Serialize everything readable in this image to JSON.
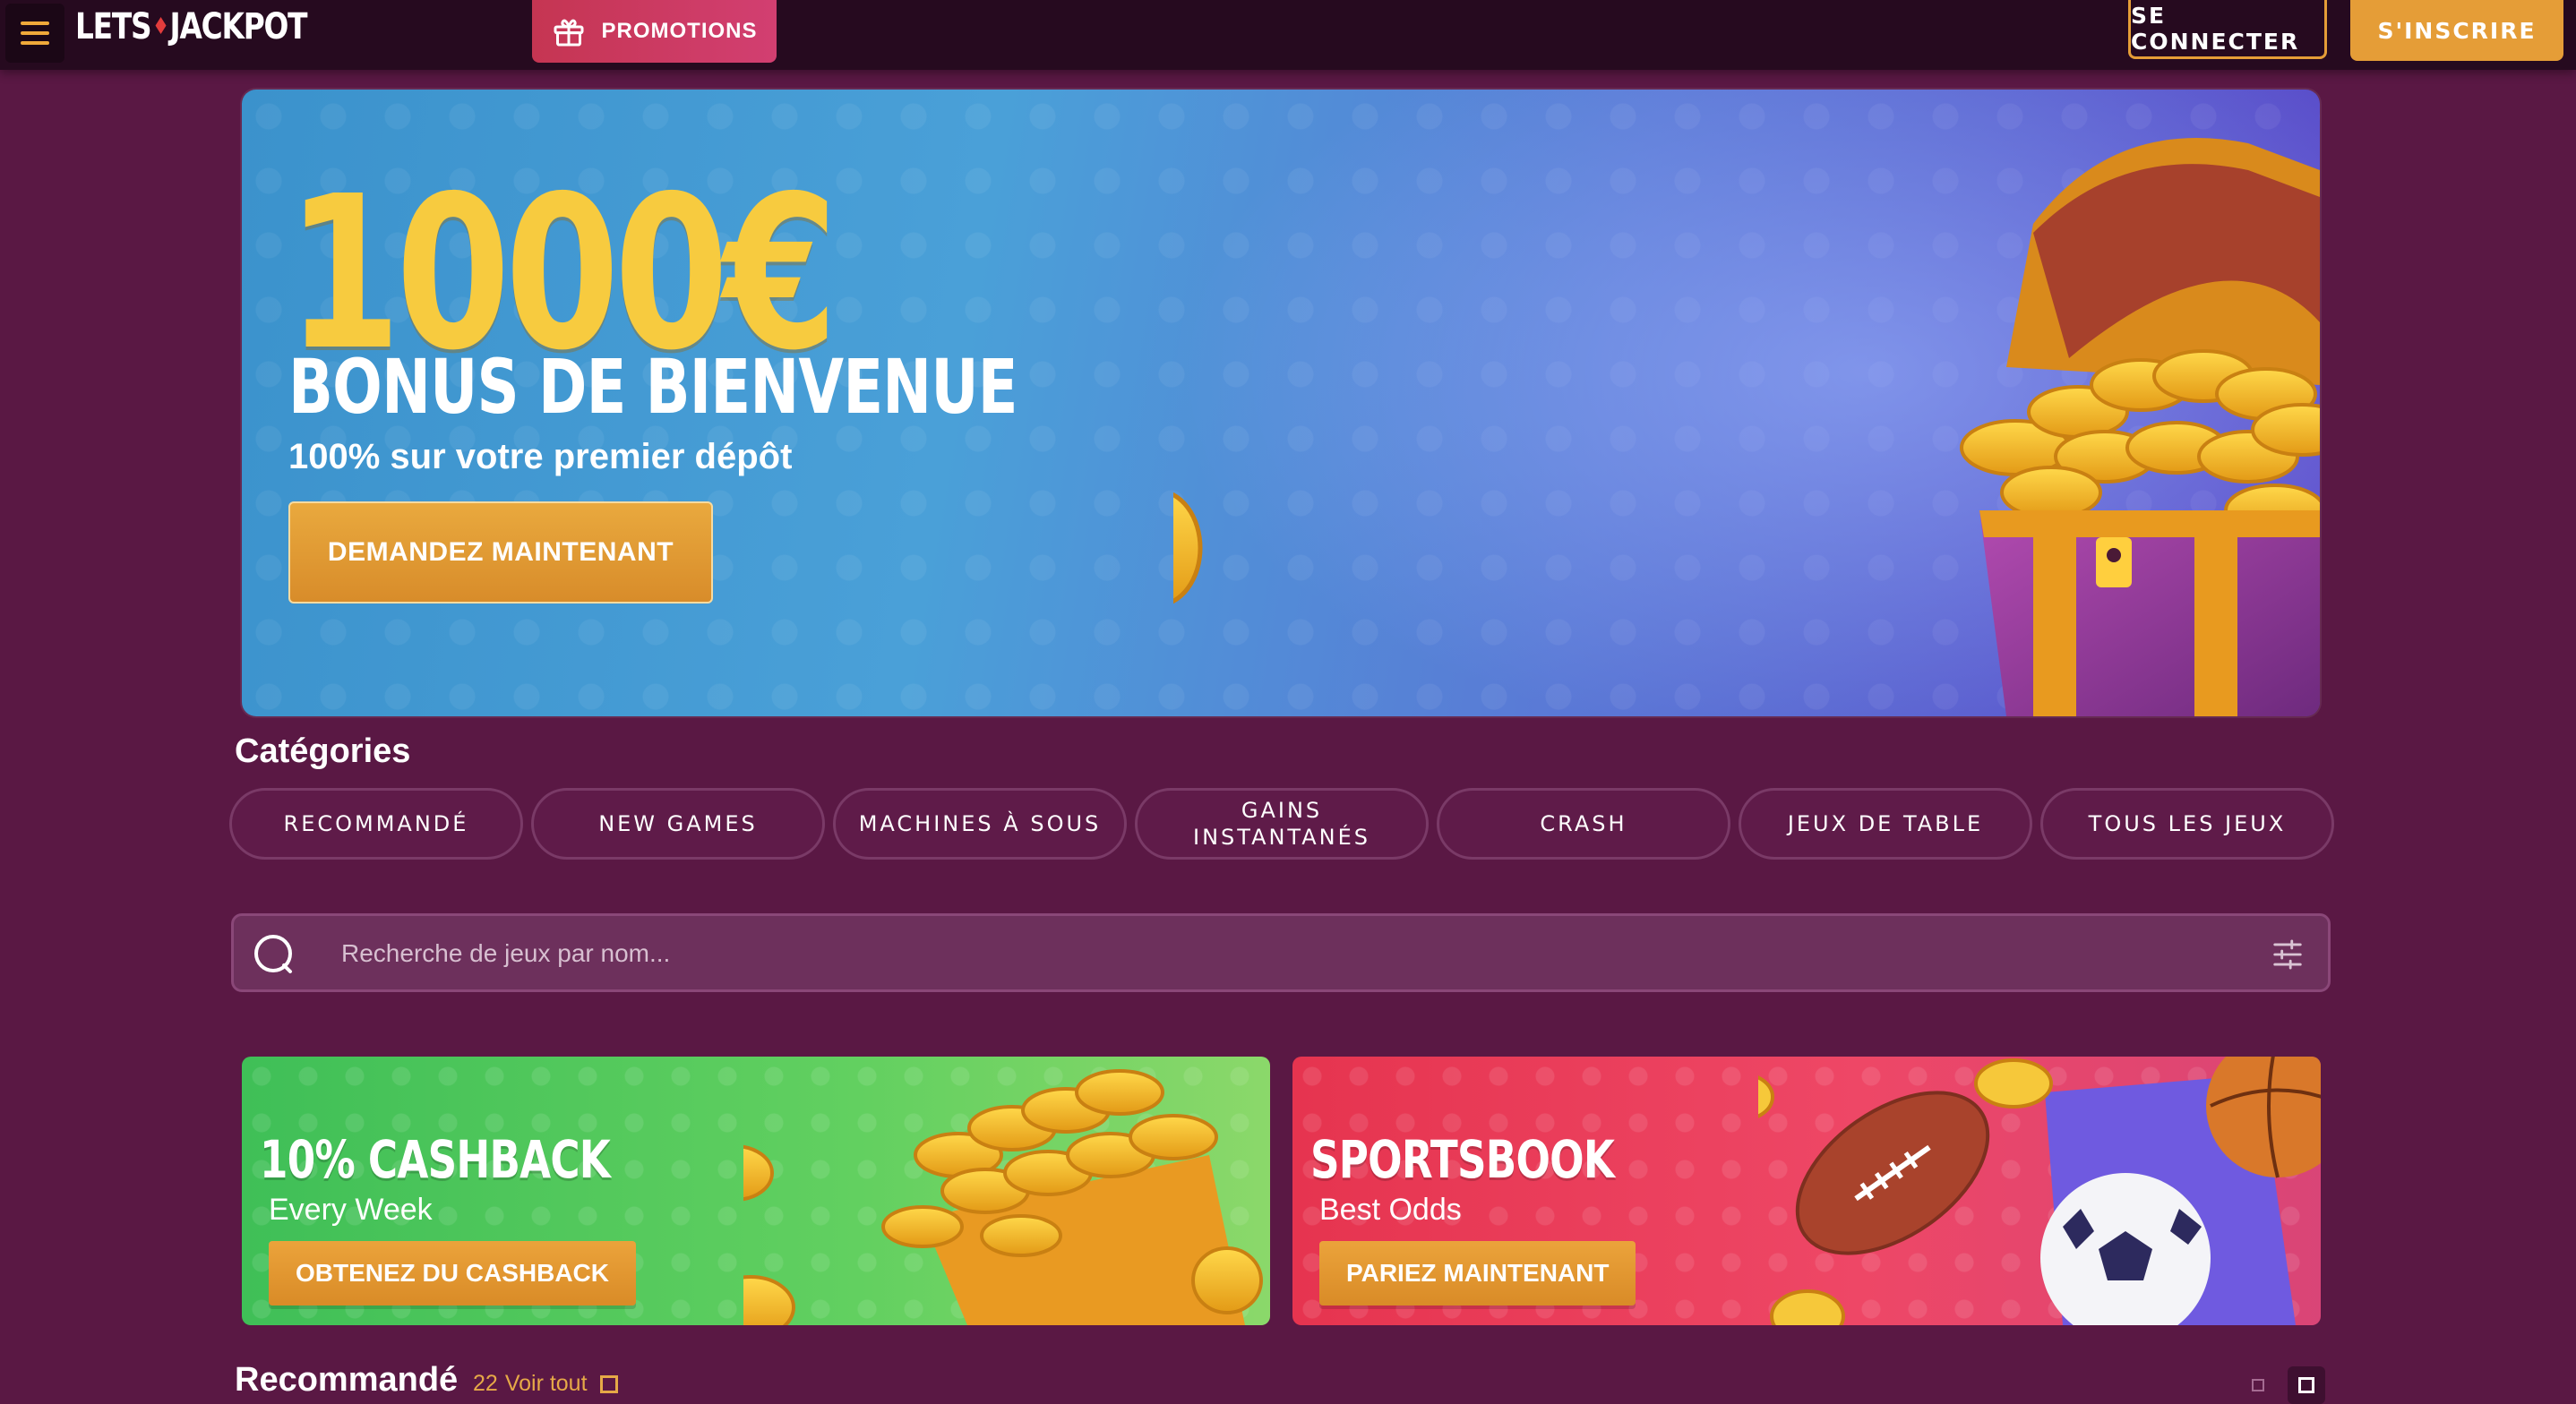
{
  "header": {
    "logo_text_left": "LETS",
    "logo_text_right": "JACKPOT",
    "promotions_label": "PROMOTIONS",
    "login_label": "SE CONNECTER",
    "signup_label": "S'INSCRIRE"
  },
  "hero": {
    "amount": "1000€",
    "title": "BONUS DE BIENVENUE",
    "subtitle": "100% sur votre premier dépôt",
    "cta_label": "DEMANDEZ MAINTENANT"
  },
  "categories": {
    "title": "Catégories",
    "items": [
      {
        "label": "RECOMMANDÉ"
      },
      {
        "label": "NEW GAMES"
      },
      {
        "label": "MACHINES À SOUS"
      },
      {
        "label": "GAINS INSTANTANÉS"
      },
      {
        "label": "CRASH"
      },
      {
        "label": "JEUX DE TABLE"
      },
      {
        "label": "TOUS LES JEUX"
      }
    ]
  },
  "search": {
    "placeholder": "Recherche de jeux par nom..."
  },
  "promo_cards": [
    {
      "title": "10% CASHBACK",
      "subtitle": "Every Week",
      "cta_label": "OBTENEZ DU CASHBACK"
    },
    {
      "title": "SPORTSBOOK",
      "subtitle": "Best Odds",
      "cta_label": "PARIEZ MAINTENANT"
    }
  ],
  "recommended": {
    "title": "Recommandé",
    "count": "22",
    "view_all_label": "Voir tout"
  },
  "colors": {
    "background": "#5a1844",
    "header": "#260a1f",
    "accent_orange": "#e59d37",
    "promo_pink": "#c53552",
    "hero_gold": "#f7cb3f",
    "cashback_green": "#4ec65a",
    "sports_red": "#e6344f"
  }
}
